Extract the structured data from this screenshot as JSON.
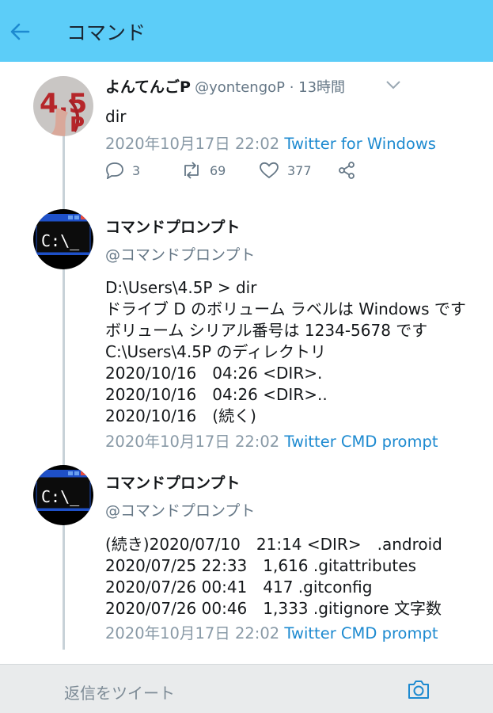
{
  "header": {
    "title": "コマンド",
    "back_icon": "arrow-left-icon"
  },
  "colors": {
    "header_bg": "#5ccdf8",
    "link": "#1d8ad0",
    "muted": "#8899a6"
  },
  "tweets": [
    {
      "display_name": "よんてんごP",
      "handle": "@yontengoP · 13時間",
      "text_lines": [
        "dir"
      ],
      "timestamp": "2020年10月17日 22:02",
      "source": "Twitter for Windows",
      "replies": "3",
      "retweets": "69",
      "likes": "377"
    },
    {
      "display_name": "コマンドプロンプト",
      "handle": "@コマンドプロンプト",
      "text_lines": [
        "D:\\Users\\4.5P > dir",
        "ドライブ D のボリューム ラベルは Windows です",
        "ボリューム シリアル番号は 1234-5678 です",
        "C:\\Users\\4.5P のディレクトリ",
        "2020/10/16　04:26 <DIR>.",
        "2020/10/16　04:26 <DIR>..",
        "2020/10/16　(続く)"
      ],
      "timestamp": "2020年10月17日 22:02",
      "source": "Twitter CMD prompt"
    },
    {
      "display_name": "コマンドプロンプト",
      "handle": "@コマンドプロンプト",
      "text_lines": [
        "(続き)2020/07/10　21:14 <DIR>　.android",
        "2020/07/25  22:33　1,616 .gitattributes",
        "2020/07/26  00:41　417 .gitconfig",
        "2020/07/26  00:46　1,333 .gitignore 文字数"
      ],
      "timestamp": "2020年10月17日 22:02",
      "source": "Twitter CMD prompt"
    }
  ],
  "reply_bar": {
    "placeholder": "返信をツイート",
    "camera_icon": "camera-icon"
  }
}
